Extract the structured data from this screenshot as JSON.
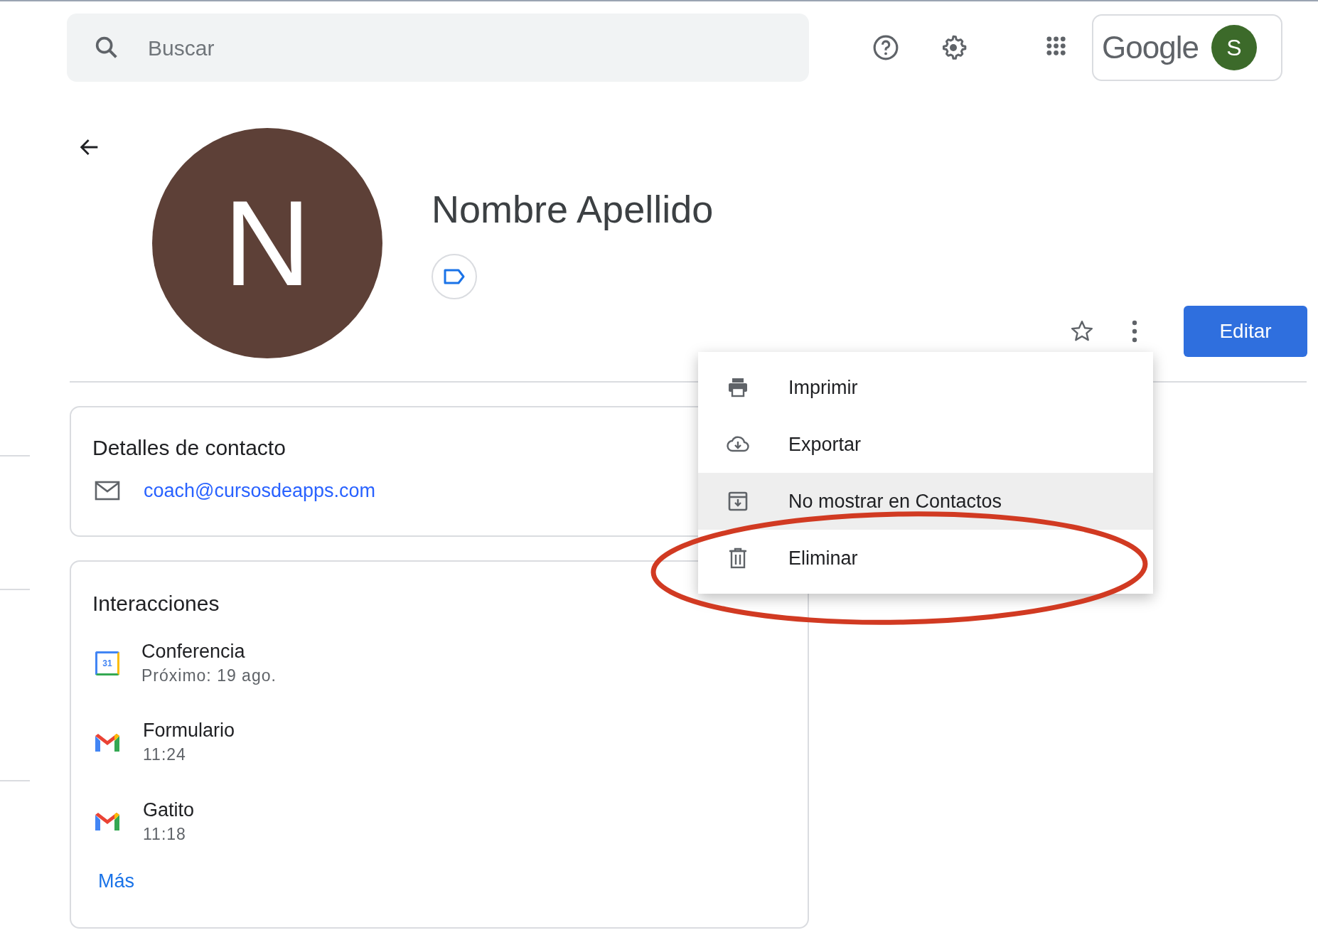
{
  "search": {
    "placeholder": "Buscar"
  },
  "account": {
    "brand": "Google",
    "initial": "S"
  },
  "contact": {
    "initial": "N",
    "name": "Nombre Apellido"
  },
  "menu": [
    {
      "kind": "print",
      "label": "Imprimir",
      "highlighted": false
    },
    {
      "kind": "export",
      "label": "Exportar",
      "highlighted": false
    },
    {
      "kind": "hide",
      "label": "No mostrar en Contactos",
      "highlighted": true
    },
    {
      "kind": "delete",
      "label": "Eliminar",
      "highlighted": false
    }
  ],
  "edit_button": "Editar",
  "details": {
    "title": "Detalles de contacto",
    "email": "coach@cursosdeapps.com"
  },
  "interactions": {
    "title": "Interacciones",
    "items": [
      {
        "kind": "calendar",
        "icon_text": "31",
        "title": "Conferencia",
        "subtitle": "Próximo: 19 ago."
      },
      {
        "kind": "mail",
        "title": "Formulario",
        "subtitle": "11:24"
      },
      {
        "kind": "mail",
        "title": "Gatito",
        "subtitle": "11:18"
      }
    ],
    "more": "Más"
  }
}
